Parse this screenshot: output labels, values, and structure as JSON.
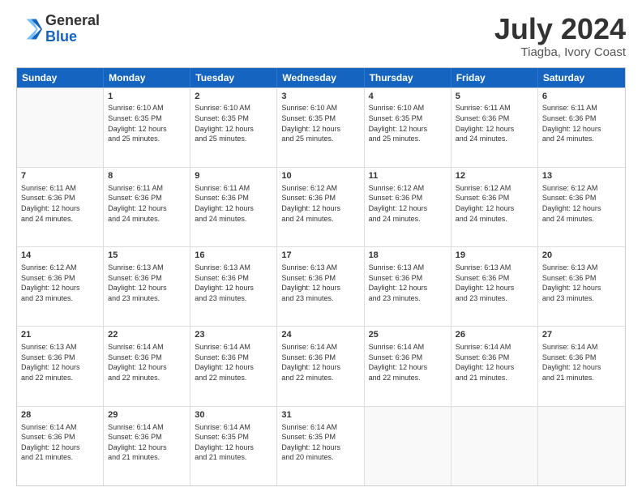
{
  "logo": {
    "general": "General",
    "blue": "Blue"
  },
  "header": {
    "title": "July 2024",
    "subtitle": "Tiagba, Ivory Coast"
  },
  "calendar": {
    "days": [
      "Sunday",
      "Monday",
      "Tuesday",
      "Wednesday",
      "Thursday",
      "Friday",
      "Saturday"
    ],
    "rows": [
      [
        {
          "day": "",
          "info": ""
        },
        {
          "day": "1",
          "info": "Sunrise: 6:10 AM\nSunset: 6:35 PM\nDaylight: 12 hours\nand 25 minutes."
        },
        {
          "day": "2",
          "info": "Sunrise: 6:10 AM\nSunset: 6:35 PM\nDaylight: 12 hours\nand 25 minutes."
        },
        {
          "day": "3",
          "info": "Sunrise: 6:10 AM\nSunset: 6:35 PM\nDaylight: 12 hours\nand 25 minutes."
        },
        {
          "day": "4",
          "info": "Sunrise: 6:10 AM\nSunset: 6:35 PM\nDaylight: 12 hours\nand 25 minutes."
        },
        {
          "day": "5",
          "info": "Sunrise: 6:11 AM\nSunset: 6:36 PM\nDaylight: 12 hours\nand 24 minutes."
        },
        {
          "day": "6",
          "info": "Sunrise: 6:11 AM\nSunset: 6:36 PM\nDaylight: 12 hours\nand 24 minutes."
        }
      ],
      [
        {
          "day": "7",
          "info": "Sunrise: 6:11 AM\nSunset: 6:36 PM\nDaylight: 12 hours\nand 24 minutes."
        },
        {
          "day": "8",
          "info": "Sunrise: 6:11 AM\nSunset: 6:36 PM\nDaylight: 12 hours\nand 24 minutes."
        },
        {
          "day": "9",
          "info": "Sunrise: 6:11 AM\nSunset: 6:36 PM\nDaylight: 12 hours\nand 24 minutes."
        },
        {
          "day": "10",
          "info": "Sunrise: 6:12 AM\nSunset: 6:36 PM\nDaylight: 12 hours\nand 24 minutes."
        },
        {
          "day": "11",
          "info": "Sunrise: 6:12 AM\nSunset: 6:36 PM\nDaylight: 12 hours\nand 24 minutes."
        },
        {
          "day": "12",
          "info": "Sunrise: 6:12 AM\nSunset: 6:36 PM\nDaylight: 12 hours\nand 24 minutes."
        },
        {
          "day": "13",
          "info": "Sunrise: 6:12 AM\nSunset: 6:36 PM\nDaylight: 12 hours\nand 24 minutes."
        }
      ],
      [
        {
          "day": "14",
          "info": "Sunrise: 6:12 AM\nSunset: 6:36 PM\nDaylight: 12 hours\nand 23 minutes."
        },
        {
          "day": "15",
          "info": "Sunrise: 6:13 AM\nSunset: 6:36 PM\nDaylight: 12 hours\nand 23 minutes."
        },
        {
          "day": "16",
          "info": "Sunrise: 6:13 AM\nSunset: 6:36 PM\nDaylight: 12 hours\nand 23 minutes."
        },
        {
          "day": "17",
          "info": "Sunrise: 6:13 AM\nSunset: 6:36 PM\nDaylight: 12 hours\nand 23 minutes."
        },
        {
          "day": "18",
          "info": "Sunrise: 6:13 AM\nSunset: 6:36 PM\nDaylight: 12 hours\nand 23 minutes."
        },
        {
          "day": "19",
          "info": "Sunrise: 6:13 AM\nSunset: 6:36 PM\nDaylight: 12 hours\nand 23 minutes."
        },
        {
          "day": "20",
          "info": "Sunrise: 6:13 AM\nSunset: 6:36 PM\nDaylight: 12 hours\nand 23 minutes."
        }
      ],
      [
        {
          "day": "21",
          "info": "Sunrise: 6:13 AM\nSunset: 6:36 PM\nDaylight: 12 hours\nand 22 minutes."
        },
        {
          "day": "22",
          "info": "Sunrise: 6:14 AM\nSunset: 6:36 PM\nDaylight: 12 hours\nand 22 minutes."
        },
        {
          "day": "23",
          "info": "Sunrise: 6:14 AM\nSunset: 6:36 PM\nDaylight: 12 hours\nand 22 minutes."
        },
        {
          "day": "24",
          "info": "Sunrise: 6:14 AM\nSunset: 6:36 PM\nDaylight: 12 hours\nand 22 minutes."
        },
        {
          "day": "25",
          "info": "Sunrise: 6:14 AM\nSunset: 6:36 PM\nDaylight: 12 hours\nand 22 minutes."
        },
        {
          "day": "26",
          "info": "Sunrise: 6:14 AM\nSunset: 6:36 PM\nDaylight: 12 hours\nand 21 minutes."
        },
        {
          "day": "27",
          "info": "Sunrise: 6:14 AM\nSunset: 6:36 PM\nDaylight: 12 hours\nand 21 minutes."
        }
      ],
      [
        {
          "day": "28",
          "info": "Sunrise: 6:14 AM\nSunset: 6:36 PM\nDaylight: 12 hours\nand 21 minutes."
        },
        {
          "day": "29",
          "info": "Sunrise: 6:14 AM\nSunset: 6:36 PM\nDaylight: 12 hours\nand 21 minutes."
        },
        {
          "day": "30",
          "info": "Sunrise: 6:14 AM\nSunset: 6:35 PM\nDaylight: 12 hours\nand 21 minutes."
        },
        {
          "day": "31",
          "info": "Sunrise: 6:14 AM\nSunset: 6:35 PM\nDaylight: 12 hours\nand 20 minutes."
        },
        {
          "day": "",
          "info": ""
        },
        {
          "day": "",
          "info": ""
        },
        {
          "day": "",
          "info": ""
        }
      ]
    ]
  }
}
